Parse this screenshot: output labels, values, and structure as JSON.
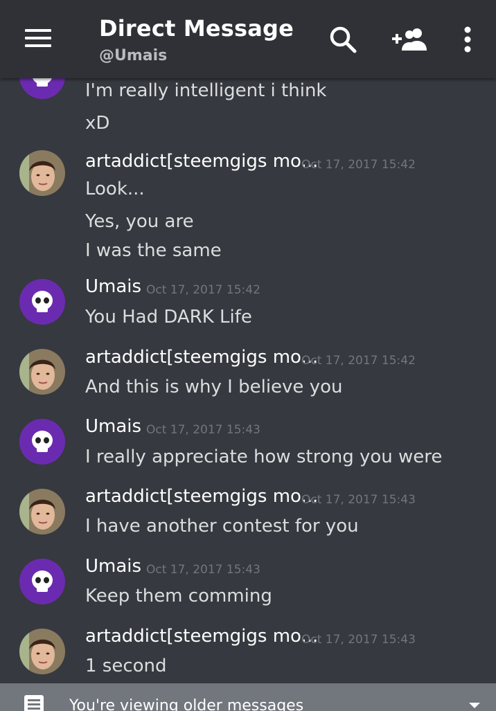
{
  "header": {
    "title": "Direct Message",
    "subtitle": "@Umais",
    "icons": [
      "menu-icon",
      "search-icon",
      "add-friend-icon",
      "more-icon"
    ]
  },
  "messages": [
    {
      "author": "",
      "timestamp": "",
      "lines": [
        "I'm really intelligent i think",
        "xD"
      ],
      "avatar": "skull-avatar-partial"
    },
    {
      "author": "artaddict[steemgigs mo...",
      "timestamp": "Oct 17, 2017 15:42",
      "lines": [
        "Look...",
        "Yes, you are",
        "I was the same"
      ],
      "avatar": "photo-avatar"
    },
    {
      "author": "Umais",
      "timestamp": "Oct 17, 2017 15:42",
      "lines": [
        "You Had DARK Life"
      ],
      "avatar": "skull-avatar"
    },
    {
      "author": "artaddict[steemgigs mo...",
      "timestamp": "Oct 17, 2017 15:42",
      "lines": [
        "And this is why I believe you"
      ],
      "avatar": "photo-avatar"
    },
    {
      "author": "Umais",
      "timestamp": "Oct 17, 2017 15:43",
      "lines": [
        "I really appreciate how strong you were"
      ],
      "avatar": "skull-avatar"
    },
    {
      "author": "artaddict[steemgigs mo...",
      "timestamp": "Oct 17, 2017 15:43",
      "lines": [
        "I have another contest for you"
      ],
      "avatar": "photo-avatar"
    },
    {
      "author": "Umais",
      "timestamp": "Oct 17, 2017 15:43",
      "lines": [
        "Keep them comming"
      ],
      "avatar": "skull-avatar"
    },
    {
      "author": "artaddict[steemgigs mo...",
      "timestamp": "Oct 17, 2017 15:43",
      "lines": [
        "1 second"
      ],
      "avatar": "photo-avatar"
    }
  ],
  "banner": {
    "text": "You're viewing older messages",
    "icon": "message-icon",
    "caret": "chevron-down-icon"
  },
  "colors": {
    "background": "#36393f",
    "header": "#2f3136",
    "banner": "#72767d",
    "umais_avatar": "#6b2bb0"
  }
}
